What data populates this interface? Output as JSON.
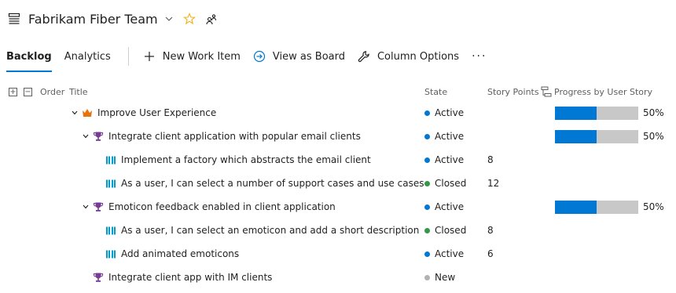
{
  "header": {
    "team_name": "Fabrikam Fiber Team"
  },
  "toolbar": {
    "tabs": [
      {
        "label": "Backlog"
      },
      {
        "label": "Analytics"
      }
    ],
    "new_work_item": "New Work Item",
    "view_as_board": "View as Board",
    "column_options": "Column Options",
    "more": "···"
  },
  "columns": {
    "order": "Order",
    "title": "Title",
    "state": "State",
    "story_points": "Story Points",
    "progress": "Progress by User Story"
  },
  "state_colors": {
    "Active": "#0078d4",
    "Closed": "#339947",
    "New": "#b2b2b2"
  },
  "accent": "#0078d4",
  "rows": [
    {
      "type": "epic",
      "icon": "crown-icon",
      "expanded": true,
      "title": "Improve User Experience",
      "state": "Active",
      "points": "",
      "progress": 0.5,
      "progress_label": "50%"
    },
    {
      "type": "feature",
      "icon": "trophy-icon",
      "expanded": true,
      "title": "Integrate client application with popular email clients",
      "state": "Active",
      "points": "",
      "progress": 0.5,
      "progress_label": "50%"
    },
    {
      "type": "story",
      "icon": "book-icon",
      "title": "Implement a factory which abstracts the email client",
      "state": "Active",
      "points": "8"
    },
    {
      "type": "story",
      "icon": "book-icon",
      "title": "As a user, I can select a number of support cases and use cases",
      "state": "Closed",
      "points": "12"
    },
    {
      "type": "feature",
      "icon": "trophy-icon",
      "expanded": true,
      "title": "Emoticon feedback enabled in client application",
      "state": "Active",
      "points": "",
      "progress": 0.5,
      "progress_label": "50%"
    },
    {
      "type": "story",
      "icon": "book-icon",
      "title": "As a user, I can select an emoticon and add a short description",
      "state": "Closed",
      "points": "8"
    },
    {
      "type": "story",
      "icon": "book-icon",
      "title": "Add animated emoticons",
      "state": "Active",
      "points": "6"
    },
    {
      "type": "feature",
      "icon": "trophy-icon",
      "expanded": false,
      "title": "Integrate client app with IM clients",
      "state": "New",
      "points": ""
    }
  ]
}
